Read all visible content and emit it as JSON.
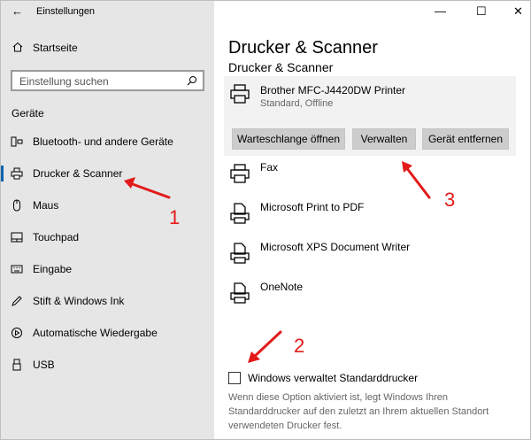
{
  "window": {
    "app_title": "Einstellungen",
    "back_glyph": "←",
    "minimize_glyph": "—",
    "maximize_glyph": "☐",
    "close_glyph": "✕"
  },
  "sidebar": {
    "home_label": "Startseite",
    "search": {
      "placeholder": "Einstellung suchen"
    },
    "section_title": "Geräte",
    "items": [
      {
        "label": "Bluetooth- und andere Geräte",
        "icon": "bluetooth-icon"
      },
      {
        "label": "Drucker & Scanner",
        "icon": "printer-icon",
        "active": true
      },
      {
        "label": "Maus",
        "icon": "mouse-icon"
      },
      {
        "label": "Touchpad",
        "icon": "touchpad-icon"
      },
      {
        "label": "Eingabe",
        "icon": "keyboard-icon"
      },
      {
        "label": "Stift & Windows Ink",
        "icon": "pen-icon"
      },
      {
        "label": "Automatische Wiedergabe",
        "icon": "autoplay-icon"
      },
      {
        "label": "USB",
        "icon": "usb-icon"
      }
    ]
  },
  "main": {
    "page_title": "Drucker & Scanner",
    "subheading": "Drucker & Scanner",
    "selected_printer": {
      "name": "Brother MFC-J4420DW Printer",
      "status": "Standard, Offline",
      "buttons": [
        "Warteschlange öffnen",
        "Verwalten",
        "Gerät entfernen"
      ]
    },
    "printers": [
      {
        "name": "Fax",
        "icon": "fax-printer-icon"
      },
      {
        "name": "Microsoft Print to PDF",
        "icon": "document-printer-icon"
      },
      {
        "name": "Microsoft XPS Document Writer",
        "icon": "document-printer-icon"
      },
      {
        "name": "OneNote",
        "icon": "document-printer-icon"
      }
    ],
    "checkbox_label": "Windows verwaltet Standarddrucker",
    "checkbox_checked": false,
    "description": "Wenn diese Option aktiviert ist, legt Windows Ihren Standarddrucker auf den zuletzt an Ihrem aktuellen Standort verwendeten Drucker fest."
  },
  "annotations": {
    "numbers": [
      "1",
      "2",
      "3"
    ],
    "arrow_color": "#e21a1a"
  },
  "colors": {
    "sidebar_bg": "#e6e6e6",
    "accent": "#0063b1",
    "button_bg": "#cccccc"
  }
}
